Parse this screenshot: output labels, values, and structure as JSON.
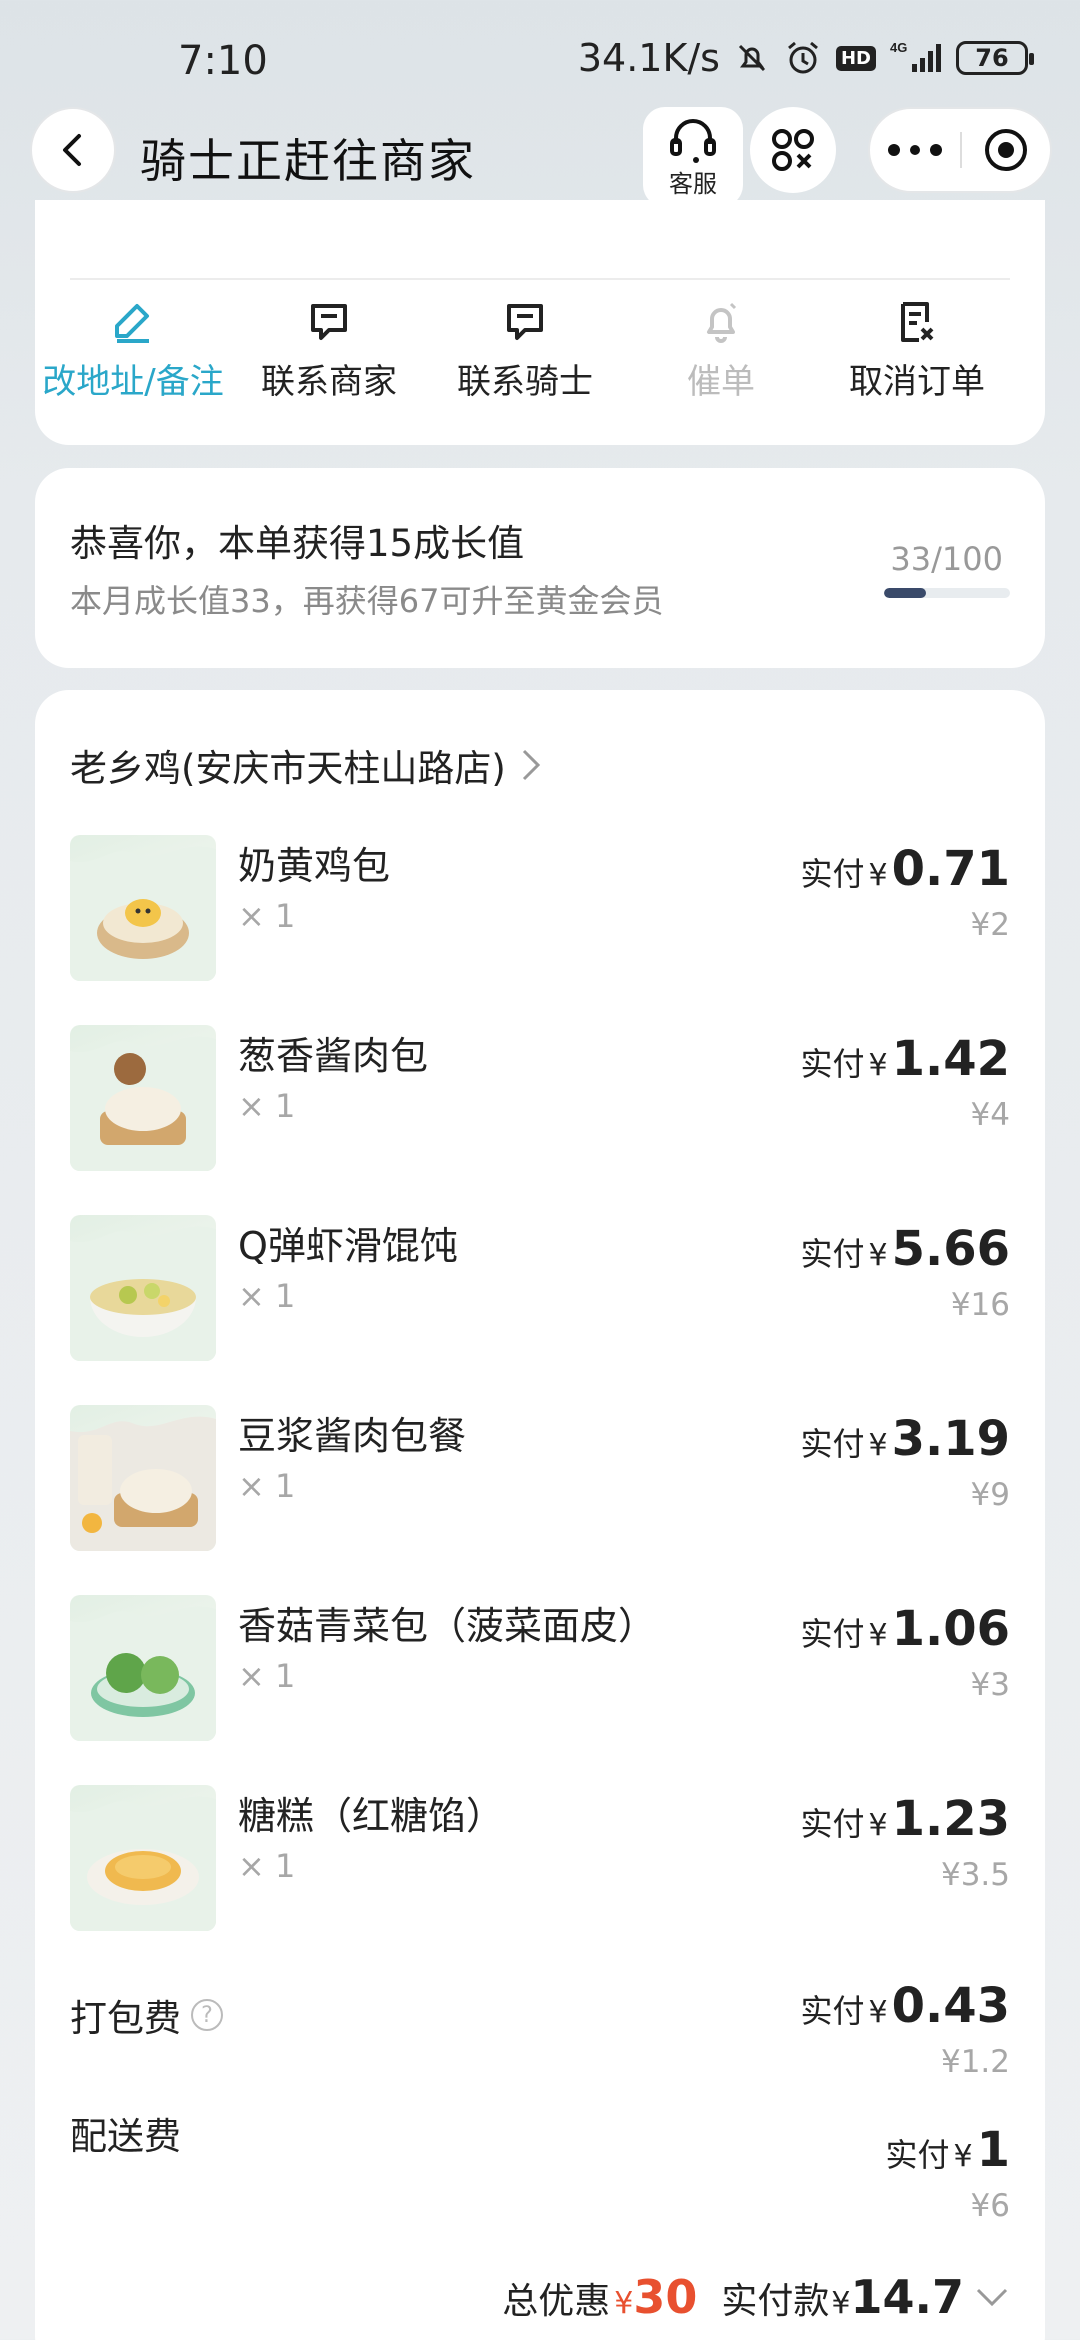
{
  "status_bar": {
    "time": "7:10",
    "speed": "34.1K/s",
    "network": "4G",
    "hd": "HD",
    "battery": "76"
  },
  "nav": {
    "title": "骑士正赶往商家",
    "service_label": "客服"
  },
  "actions": [
    {
      "label": "改地址/备注",
      "icon": "edit-icon",
      "state": "active"
    },
    {
      "label": "联系商家",
      "icon": "chat-icon",
      "state": "normal"
    },
    {
      "label": "联系骑士",
      "icon": "chat-icon",
      "state": "normal"
    },
    {
      "label": "催单",
      "icon": "bell-icon",
      "state": "disabled"
    },
    {
      "label": "取消订单",
      "icon": "cancel-doc-icon",
      "state": "normal"
    }
  ],
  "growth": {
    "title": "恭喜你，本单获得15成长值",
    "subtitle": "本月成长值33，再获得67可升至黄金会员",
    "count": "33/100",
    "progress": 0.33
  },
  "order": {
    "store": "老乡鸡(安庆市天柱山路店)",
    "paid_label": "实付",
    "yen": "¥",
    "items": [
      {
        "name": "奶黄鸡包",
        "qty": "× 1",
        "paid": "0.71",
        "original": "¥2"
      },
      {
        "name": "葱香酱肉包",
        "qty": "× 1",
        "paid": "1.42",
        "original": "¥4"
      },
      {
        "name": "Q弹虾滑馄饨",
        "qty": "× 1",
        "paid": "5.66",
        "original": "¥16"
      },
      {
        "name": "豆浆酱肉包餐",
        "qty": "× 1",
        "paid": "3.19",
        "original": "¥9"
      },
      {
        "name": "香菇青菜包（菠菜面皮）",
        "qty": "× 1",
        "paid": "1.06",
        "original": "¥3"
      },
      {
        "name": "糖糕（红糖馅）",
        "qty": "× 1",
        "paid": "1.23",
        "original": "¥3.5"
      }
    ],
    "fees": [
      {
        "label": "打包费",
        "paid": "0.43",
        "original": "¥1.2",
        "help": "?"
      },
      {
        "label": "配送费",
        "paid": "1",
        "original": "¥6"
      }
    ],
    "total": {
      "discount_label": "总优惠",
      "discount": "30",
      "pay_label": "实付款",
      "pay": "14.7"
    }
  },
  "colors": {
    "accent": "#2aa7c9",
    "discount": "#e8502f",
    "progress": "#3a4a6a"
  }
}
